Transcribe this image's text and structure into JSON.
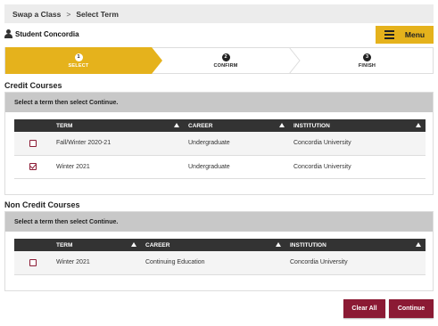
{
  "breadcrumb": {
    "items": [
      "Swap a Class",
      "Select Term"
    ],
    "separator": ">"
  },
  "user": {
    "name": "Student Concordia",
    "icon": "user-icon"
  },
  "menu": {
    "label": "Menu",
    "icon": "hamburger-icon",
    "color": "#e5b21c"
  },
  "progress": {
    "steps": [
      {
        "number": "1",
        "label": "SELECT",
        "active": true
      },
      {
        "number": "2",
        "label": "CONFIRM",
        "active": false
      },
      {
        "number": "3",
        "label": "FINISH",
        "active": false
      }
    ],
    "active_color": "#e5b21c"
  },
  "credit": {
    "title": "Credit Courses",
    "instruction": "Select a term then select Continue.",
    "columns": [
      "TERM",
      "CAREER",
      "INSTITUTION"
    ],
    "rows": [
      {
        "term": "Fall/Winter 2020-21",
        "career": "Undergraduate",
        "institution": "Concordia University",
        "checked": false
      },
      {
        "term": "Winter 2021",
        "career": "Undergraduate",
        "institution": "Concordia University",
        "checked": true
      }
    ]
  },
  "noncredit": {
    "title": "Non Credit Courses",
    "instruction": "Select a term then select Continue.",
    "columns": [
      "TERM",
      "CAREER",
      "INSTITUTION"
    ],
    "rows": [
      {
        "term": "Winter 2021",
        "career": "Continuing Education",
        "institution": "Concordia University",
        "checked": false
      }
    ]
  },
  "actions": {
    "clear_label": "Clear All",
    "continue_label": "Continue",
    "button_color": "#8b1a34"
  }
}
